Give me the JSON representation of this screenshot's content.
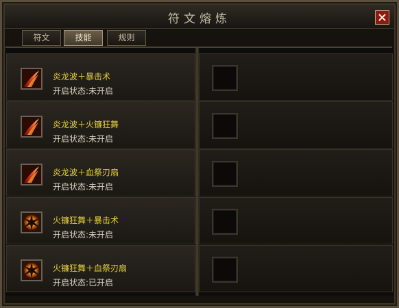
{
  "window": {
    "title": "符文熔炼"
  },
  "tabs": [
    {
      "label": "符文",
      "active": false
    },
    {
      "label": "技能",
      "active": true
    },
    {
      "label": "规则",
      "active": false
    }
  ],
  "skills": [
    {
      "name": "炎龙波＋暴击术",
      "status": "开启状态:未开启",
      "icon": "flame-slash-icon"
    },
    {
      "name": "炎龙波＋火镰狂舞",
      "status": "开启状态:未开启",
      "icon": "flame-slash-icon"
    },
    {
      "name": "炎龙波＋血祭刃扇",
      "status": "开启状态:未开启",
      "icon": "flame-slash-icon"
    },
    {
      "name": "火镰狂舞＋暴击术",
      "status": "开启状态:未开启",
      "icon": "fire-burst-icon"
    },
    {
      "name": "火镰狂舞＋血祭刃扇",
      "status": "开启状态:已开启",
      "icon": "fire-burst-icon"
    }
  ],
  "colors": {
    "skill_name": "#e6d23c",
    "status_text": "#d8d1bf",
    "close_button": "#8b1a13"
  }
}
